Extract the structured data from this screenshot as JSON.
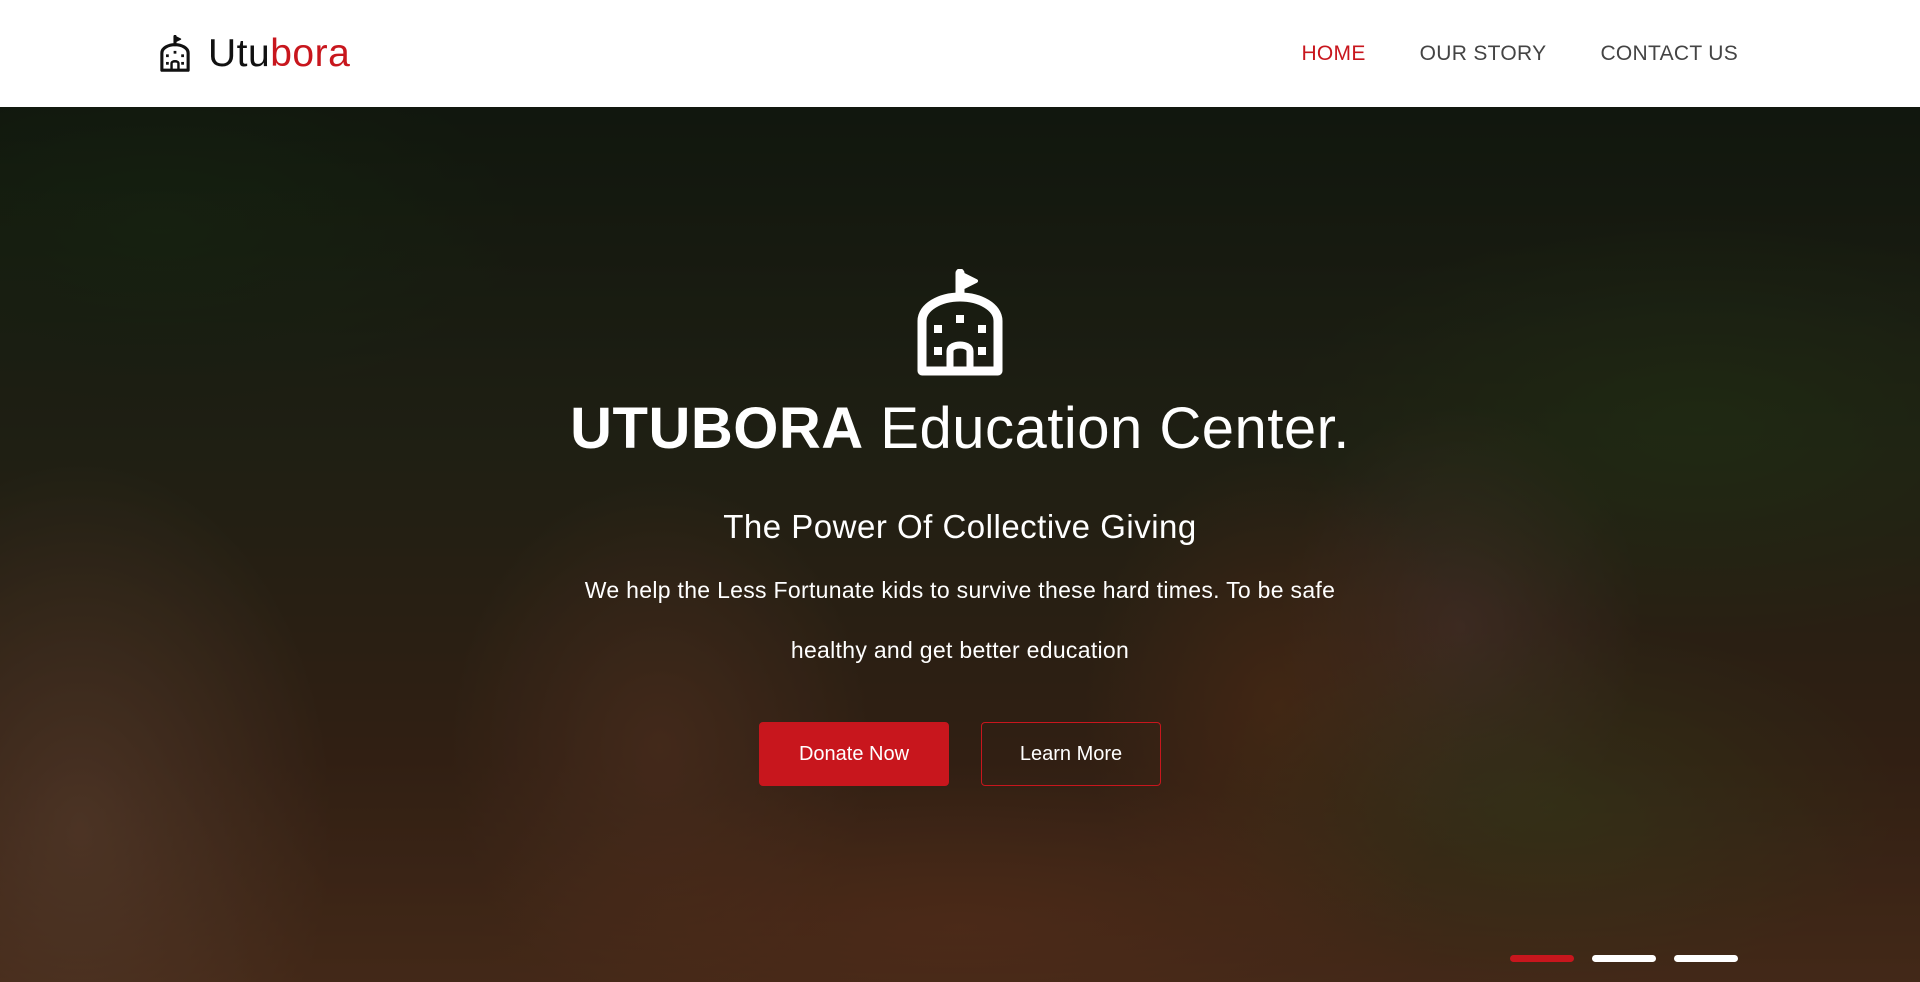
{
  "brand": {
    "name_part1": "Utu",
    "name_part2": "bora",
    "icon": "school-icon"
  },
  "nav": {
    "items": [
      {
        "label": "HOME",
        "active": true
      },
      {
        "label": "OUR STORY",
        "active": false
      },
      {
        "label": "CONTACT US",
        "active": false
      }
    ]
  },
  "hero": {
    "icon": "school-icon",
    "title_bold": "UTUBORA",
    "title_rest": " Education Center.",
    "subtitle": "The Power Of Collective Giving",
    "description": "We help the Less Fortunate kids to survive these hard times. To be safe healthy and get better education",
    "primary_button": "Donate Now",
    "secondary_button": "Learn More"
  },
  "slider": {
    "count": 3,
    "active_index": 0
  },
  "colors": {
    "accent": "#c8161d",
    "nav_text": "#444444",
    "background": "#ffffff"
  }
}
